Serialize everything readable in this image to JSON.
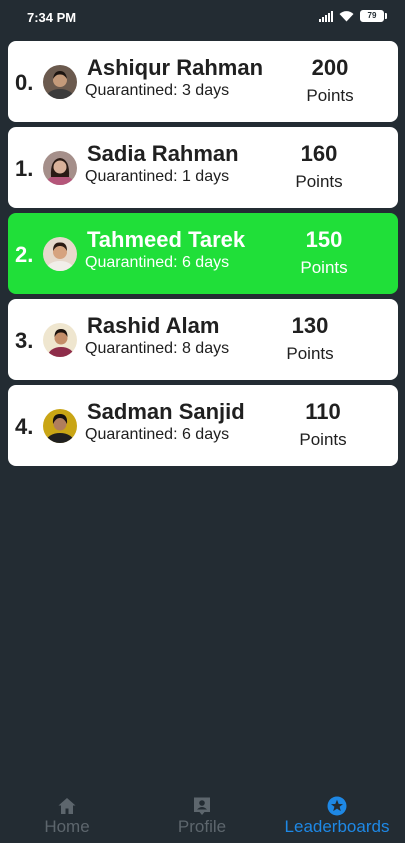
{
  "status_bar": {
    "time": "7:34 PM",
    "battery": "79"
  },
  "leaderboard": [
    {
      "rank": "0.",
      "name": "Ashiqur Rahman",
      "days": "Quarantined: 3 days",
      "points": "200",
      "points_label": "Points",
      "avatar_bg": "#6b5a4e",
      "avatar_skin": "#c49a7a",
      "avatar_hair": "#1c1410",
      "avatar_shirt": "#3b3b3b"
    },
    {
      "rank": "1.",
      "name": "Sadia Rahman",
      "days": "Quarantined: 1 days",
      "points": "160",
      "points_label": "Points",
      "avatar_bg": "#a58f8a",
      "avatar_skin": "#d9b19a",
      "avatar_hair": "#2a1a14",
      "avatar_shirt": "#b5567a"
    },
    {
      "rank": "2.",
      "name": "Tahmeed Tarek",
      "days": "Quarantined: 6 days",
      "points": "150",
      "points_label": "Points",
      "avatar_bg": "#e7d9cc",
      "avatar_skin": "#d6a37f",
      "avatar_hair": "#2b1a12",
      "avatar_shirt": "#f1eee9"
    },
    {
      "rank": "3.",
      "name": "Rashid Alam",
      "days": "Quarantined: 8 days",
      "points": "130",
      "points_label": "Points",
      "avatar_bg": "#efe6cf",
      "avatar_skin": "#c48d68",
      "avatar_hair": "#1c120d",
      "avatar_shirt": "#8e2d4a"
    },
    {
      "rank": "4.",
      "name": "Sadman Sanjid",
      "days": "Quarantined: 6 days",
      "points": "110",
      "points_label": "Points",
      "avatar_bg": "#c9a515",
      "avatar_skin": "#b07e5d",
      "avatar_hair": "#151010",
      "avatar_shirt": "#1f1f1f"
    }
  ],
  "nav": [
    {
      "label": "Home",
      "icon": "home-icon"
    },
    {
      "label": "Profile",
      "icon": "profile-icon"
    },
    {
      "label": "Leaderboards",
      "icon": "star-icon"
    }
  ],
  "colors": {
    "background": "#232c33",
    "card": "#ffffff",
    "highlight": "#20df39",
    "nav_active": "#1e88e5",
    "nav_inactive": "#5d666d"
  }
}
